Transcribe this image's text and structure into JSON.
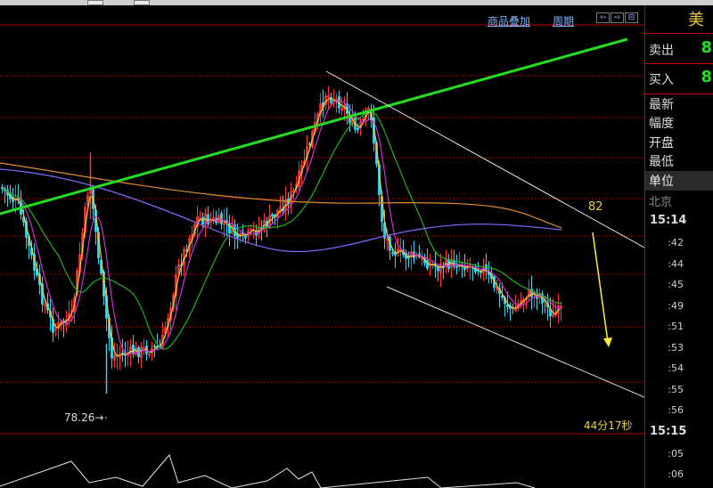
{
  "toolbar": {
    "overlay_label": "商品叠加",
    "period_label": "周期",
    "nav_icons": [
      "⇦",
      "⇨",
      "⊟"
    ]
  },
  "right_panel": {
    "title_fragment": "美",
    "sell_label": "卖出",
    "sell_value": "8",
    "buy_label": "买入",
    "buy_value": "8",
    "latest_label": "最新",
    "change_label": "幅度",
    "open_label": "开盘",
    "low_label": "最低",
    "unit_label": "单位",
    "region_label": "北京",
    "times": [
      {
        "time": "15:14",
        "ticks": [
          ":42",
          ":44",
          ":45",
          ":49",
          ":51",
          ":53",
          ":54",
          ":55",
          ":56"
        ]
      },
      {
        "time": "15:15",
        "ticks": [
          ":05",
          ":06"
        ]
      }
    ]
  },
  "annotations": {
    "low_price": "78.26→",
    "target_label": "82",
    "countdown": "44分17秒"
  },
  "colors": {
    "up": "#ff3333",
    "down": "#33d6f0",
    "trendline": "#22dd22",
    "channel": "#dddddd",
    "arrow": "#ffee33",
    "ma_yellow": "#e8d23a",
    "ma_magenta": "#d230d2",
    "ma_green": "#22b022",
    "ma_orange": "#e08a2a",
    "ma_purple": "#7a6cff",
    "grid": "#b00000"
  },
  "chart_data": {
    "type": "candlestick",
    "title": "",
    "visible_labels": [
      "78.26",
      "82"
    ],
    "indicators": [
      "moving averages (5 lines)",
      "green trendline",
      "descending channel",
      "projection arrow"
    ]
  }
}
